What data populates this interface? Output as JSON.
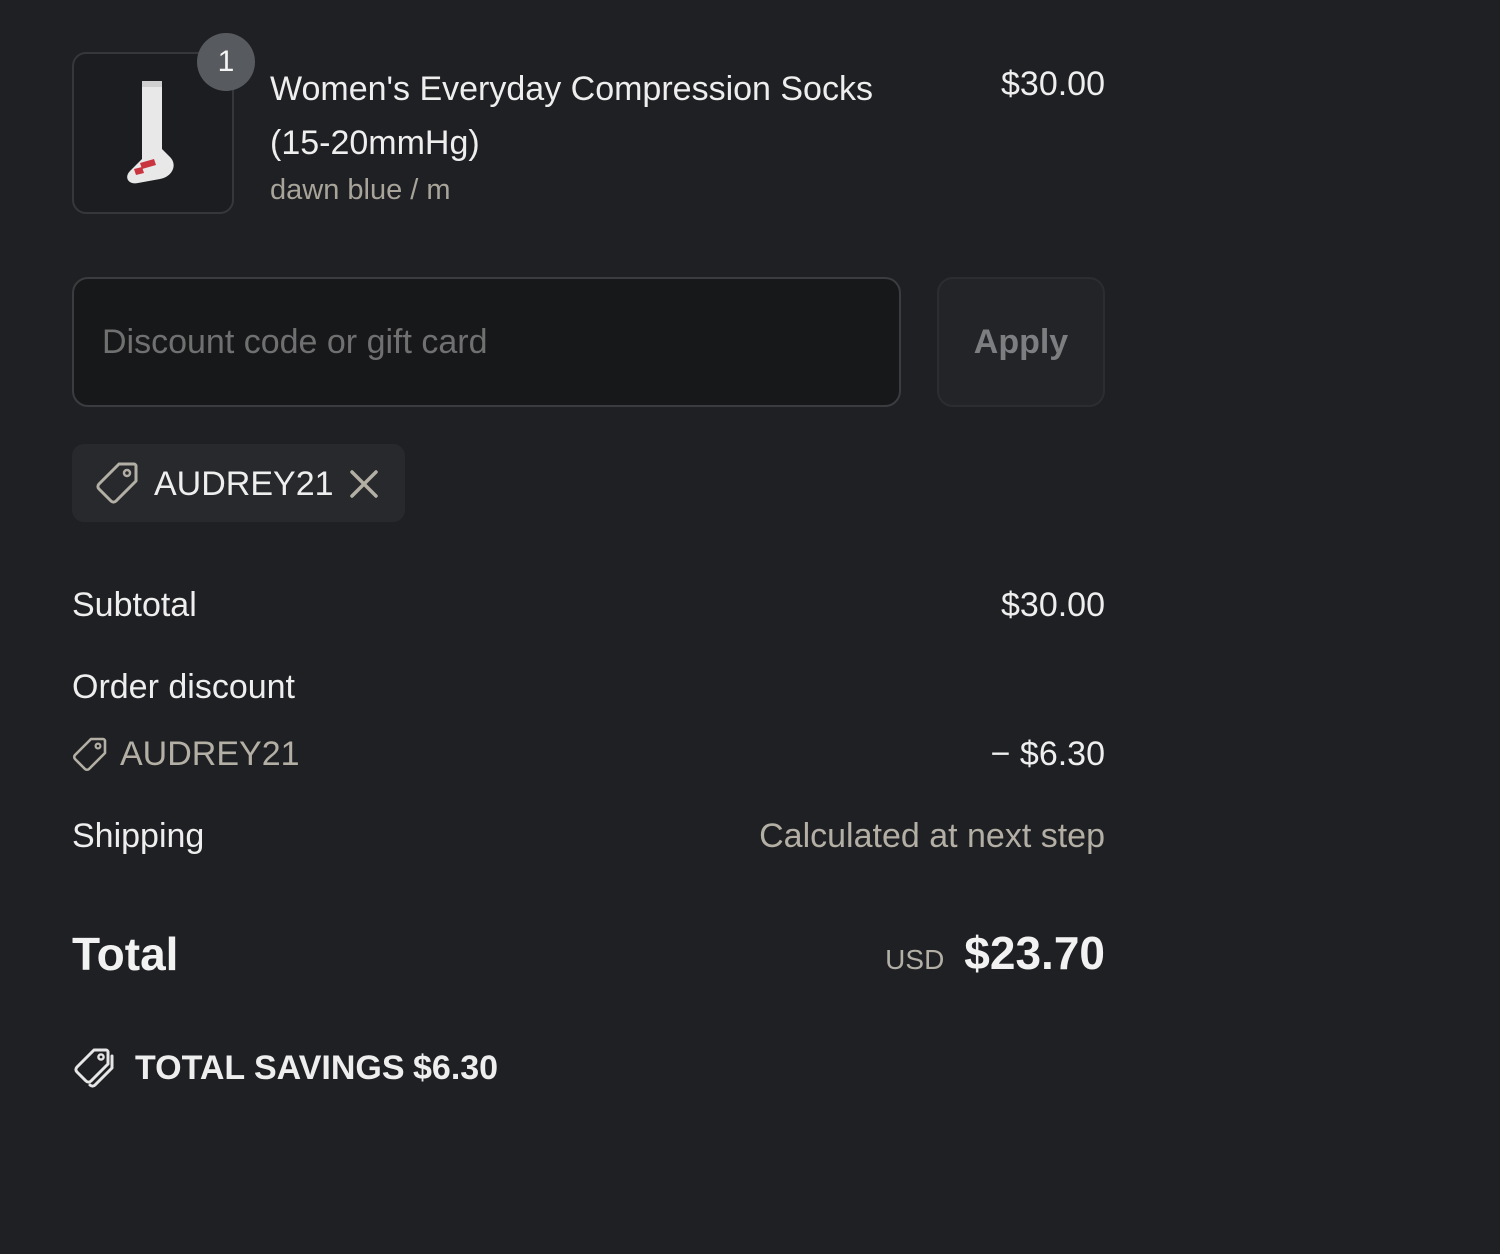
{
  "cart": {
    "item": {
      "quantity": "1",
      "name": "Women's Everyday Compression Socks (15-20mmHg)",
      "variant": "dawn blue / m",
      "price": "$30.00",
      "image_icon": "sock-icon"
    }
  },
  "discount": {
    "placeholder": "Discount code or gift card",
    "value": "",
    "apply_label": "Apply",
    "applied_code": "AUDREY21"
  },
  "totals": {
    "subtotal_label": "Subtotal",
    "subtotal_value": "$30.00",
    "order_discount_label": "Order discount",
    "order_discount_code": "AUDREY21",
    "order_discount_value": "− $6.30",
    "shipping_label": "Shipping",
    "shipping_value": "Calculated at next step",
    "total_label": "Total",
    "currency": "USD",
    "total_value": "$23.70",
    "savings_label": "TOTAL SAVINGS",
    "savings_value": "$6.30"
  },
  "colors": {
    "background": "#1f2023",
    "text": "#eeeeee",
    "muted_text": "#b3afa5",
    "input_background": "#17181a",
    "badge": "#575a5f"
  }
}
